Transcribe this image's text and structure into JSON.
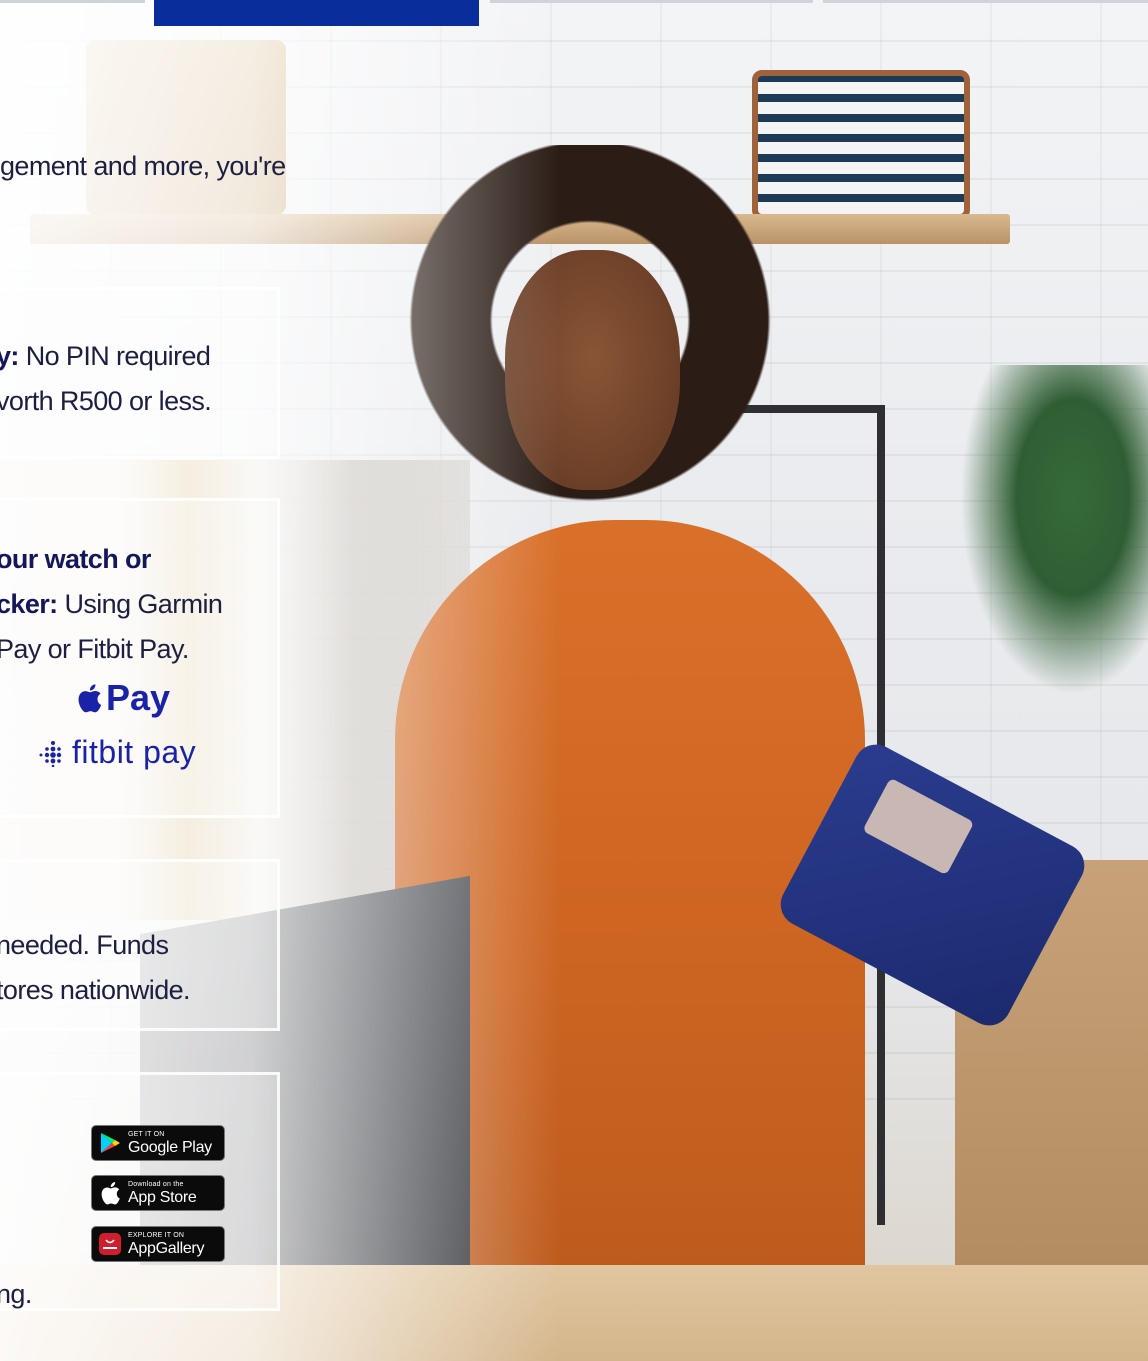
{
  "colors": {
    "brand_blue": "#0a2d9c",
    "pay_logo_blue": "#1a23a8",
    "text_dark": "#1c1f3f",
    "huawei_red": "#cf1f2e"
  },
  "intro": {
    "text": "gement and more, you're"
  },
  "cards": {
    "pin": {
      "bold": "y:",
      "line1": " No PIN required",
      "line2": "vorth R500 or less."
    },
    "wearable": {
      "line1_bold": "our watch or",
      "line2_bold": "cker:",
      "line2_rest": " Using Garmin",
      "line3": "Pay or Fitbit Pay.",
      "apple_pay_label": "Pay",
      "fitbit_pay_label": "fitbit pay"
    },
    "funds": {
      "line1": "needed. Funds",
      "line2": "tores nationwide."
    },
    "apps": {
      "google_small": "GET IT ON",
      "google_large": "Google Play",
      "apple_small": "Download on the",
      "apple_large": "App Store",
      "huawei_small": "EXPLORE IT ON",
      "huawei_large": "AppGallery",
      "footer": "ng."
    }
  },
  "icons": [
    "apple-icon",
    "fitbit-icon",
    "google-play-icon",
    "apple-store-icon",
    "huawei-icon"
  ]
}
